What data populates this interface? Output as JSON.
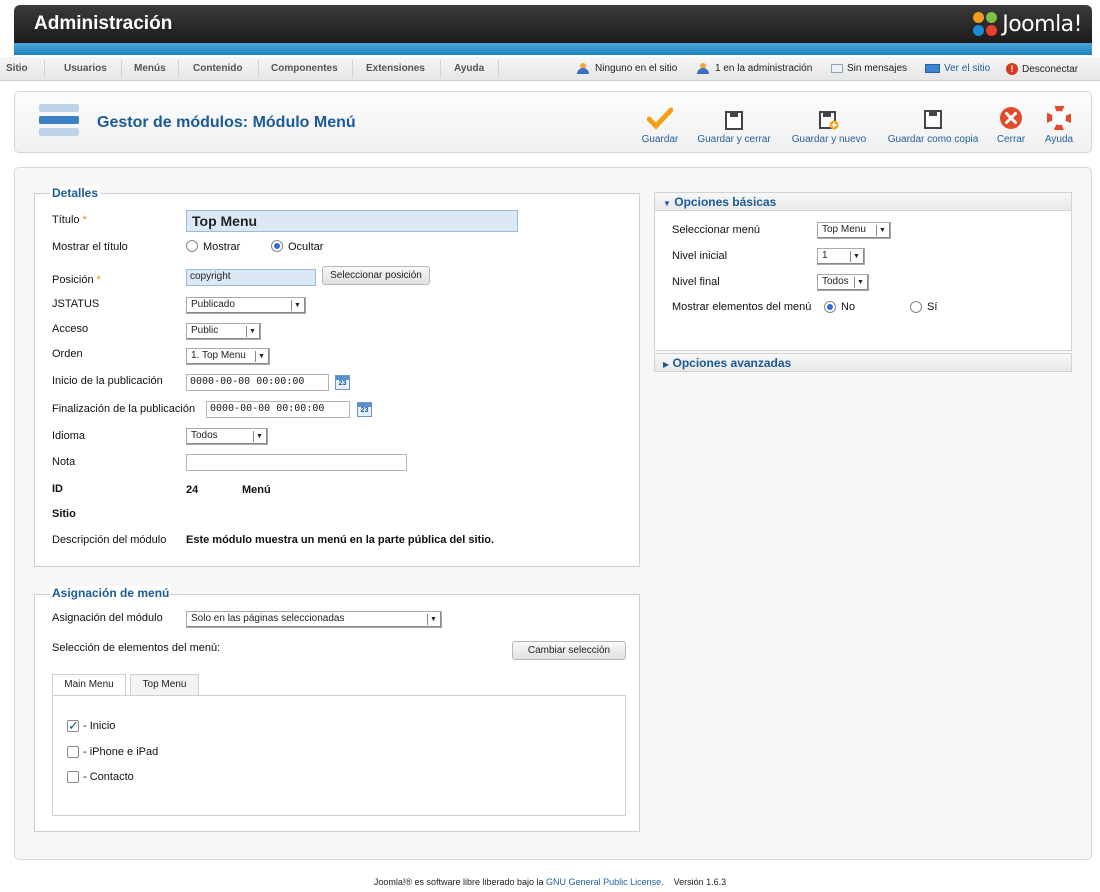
{
  "header": {
    "title": "Administración",
    "logo_text": "Joomla!"
  },
  "menubar": {
    "items": [
      "Sitio",
      "Usuarios",
      "Menús",
      "Contenido",
      "Componentes",
      "Extensiones",
      "Ayuda"
    ],
    "status": {
      "site_users": "Ninguno en el sitio",
      "admin_users": "1 en la administración",
      "messages": "Sin mensajes",
      "view_site": "Ver el sitio",
      "logout": "Desconectar"
    }
  },
  "toolbar": {
    "title": "Gestor de módulos: Módulo Menú",
    "buttons": [
      "Guardar",
      "Guardar y cerrar",
      "Guardar y nuevo",
      "Guardar como copia",
      "Cerrar",
      "Ayuda"
    ]
  },
  "details": {
    "legend": "Detalles",
    "title_label": "Título",
    "required_mark": "*",
    "title_value": "Top Menu",
    "show_title_label": "Mostrar el título",
    "show_option": "Mostrar",
    "hide_option": "Ocultar",
    "position_label": "Posición",
    "position_value": "copyright",
    "select_position_button": "Seleccionar posición",
    "status_label": "JSTATUS",
    "status_value": "Publicado",
    "access_label": "Acceso",
    "access_value": "Public",
    "order_label": "Orden",
    "order_value": "1. Top Menu",
    "publish_up_label": "Inicio de la publicación",
    "publish_up_value": "0000-00-00 00:00:00",
    "publish_down_label": "Finalización de la publicación",
    "publish_down_value": "0000-00-00 00:00:00",
    "calendar_day": "23",
    "language_label": "Idioma",
    "language_value": "Todos",
    "note_label": "Nota",
    "note_value": "",
    "id_label": "ID",
    "id_value": "24",
    "type_value": "Menú",
    "client_value": "Sitio",
    "desc_label": "Descripción del módulo",
    "desc_value": "Este módulo muestra un menú en la parte pública del sitio."
  },
  "assignment": {
    "legend": "Asignación de menú",
    "module_assign_label": "Asignación del módulo",
    "module_assign_value": "Solo en las páginas seleccionadas",
    "selection_label": "Selección de elementos del menú:",
    "toggle_button": "Cambiar selección",
    "tabs": [
      "Main Menu",
      "Top Menu"
    ],
    "items": [
      {
        "label": "- Inicio",
        "checked": true
      },
      {
        "label": "- iPhone e iPad",
        "checked": false
      },
      {
        "label": "- Contacto",
        "checked": false
      }
    ]
  },
  "basic_options": {
    "heading": "Opciones básicas",
    "menu_label": "Seleccionar menú",
    "menu_value": "Top Menu",
    "start_label": "Nivel inicial",
    "start_value": "1",
    "end_label": "Nivel final",
    "end_value": "Todos",
    "show_sub_label": "Mostrar elementos del menú",
    "no_option": "No",
    "yes_option": "Sí"
  },
  "advanced_options": {
    "heading": "Opciones avanzadas"
  },
  "footer": {
    "prefix": "Joomla!® es software libre liberado bajo la",
    "license": "GNU General Public License.",
    "version": "Versión 1.6.3"
  },
  "colors": {
    "accent": "#1a5a98",
    "header_bg": "#2a2a2a",
    "strip": "#2b8bc8",
    "required": "#e8800b"
  }
}
